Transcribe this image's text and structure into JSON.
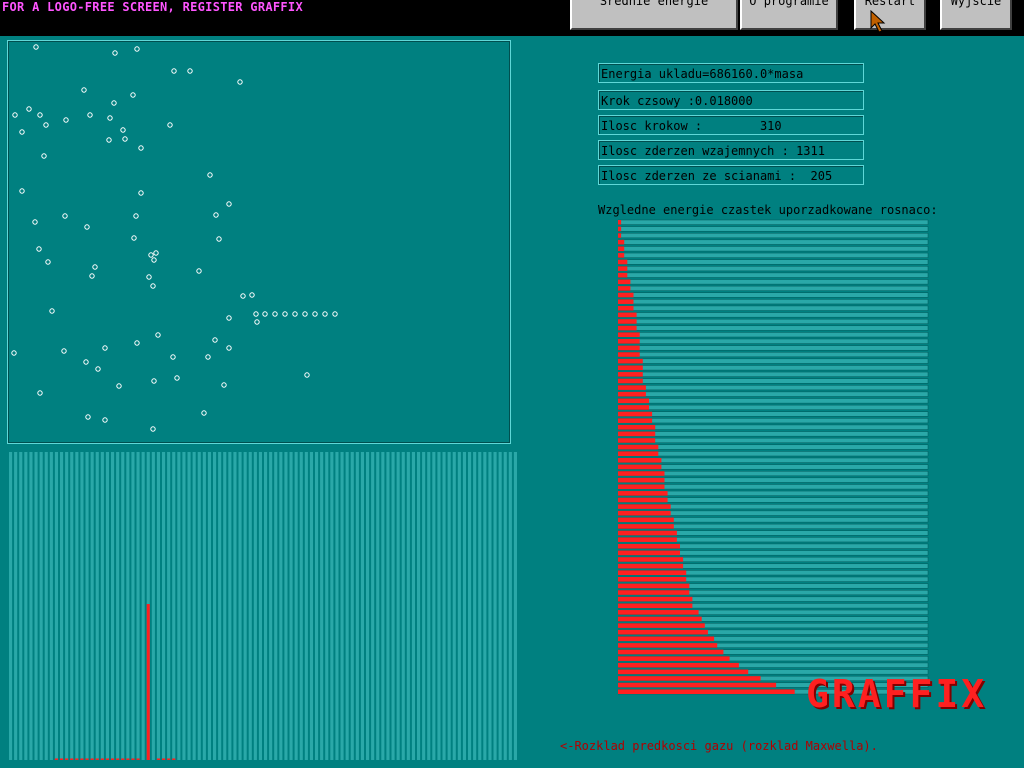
{
  "banner": "FOR A LOGO-FREE SCREEN, REGISTER GRAFFIX",
  "toolbar": {
    "buttons": [
      "Srednie energie",
      "O programie",
      "Restart",
      "Wyjscie"
    ]
  },
  "info": {
    "energy": "Energia ukladu=686160.0*masa",
    "timestep": "Krok czsowy :0.018000",
    "steps": "Ilosc krokow :        310",
    "mutual_collisions": "Ilosc zderzen wzajemnych : 1311",
    "wall_collisions": "Ilosc zderzen ze scianami :  205"
  },
  "energy_title": "Wzgledne energie czastek uporzadkowane rosnaco:",
  "logo": "GRAFFIX",
  "footer": "<-Rozklad predkosci gazu (rozklad Maxwella).",
  "colors": {
    "background": "#008080",
    "bar": "#ff2020",
    "banner": "#ff55ff",
    "footer": "#b00000"
  },
  "chart_data": [
    {
      "type": "bar",
      "title": "Wzgledne energie czastek uporzadkowane rosnaco:",
      "orientation": "horizontal",
      "values": [
        1,
        1,
        1,
        2,
        2,
        2,
        3,
        3,
        3,
        4,
        4,
        5,
        5,
        5,
        6,
        6,
        6,
        7,
        7,
        7,
        7,
        8,
        8,
        8,
        8,
        9,
        9,
        10,
        10,
        11,
        11,
        12,
        12,
        12,
        13,
        13,
        14,
        14,
        15,
        15,
        15,
        16,
        16,
        17,
        17,
        18,
        18,
        19,
        19,
        20,
        20,
        21,
        21,
        22,
        22,
        23,
        23,
        24,
        24,
        26,
        27,
        28,
        29,
        31,
        32,
        34,
        36,
        39,
        42,
        46,
        51,
        57
      ],
      "xlim": [
        0,
        100
      ]
    },
    {
      "type": "bar",
      "title": "Rozklad predkosci gazu (rozklad Maxwella)",
      "categories_count": 100,
      "values": [
        0,
        0,
        0,
        0,
        0,
        0,
        0,
        0,
        0,
        1,
        1,
        1,
        1,
        1,
        1,
        1,
        1,
        1,
        1,
        1,
        1,
        1,
        1,
        1,
        1,
        1,
        0,
        100,
        0,
        1,
        1,
        1,
        1,
        0,
        0,
        0,
        0,
        0,
        0,
        0,
        0,
        0,
        0,
        0,
        0,
        0,
        0,
        0,
        0,
        0,
        0,
        0,
        0,
        0,
        0,
        0,
        0,
        0,
        0,
        0,
        0,
        0,
        0,
        0,
        0,
        0,
        0,
        0,
        0,
        0,
        0,
        0,
        0,
        0,
        0,
        0,
        0,
        0,
        0,
        0,
        0,
        0,
        0,
        0,
        0,
        0,
        0,
        0,
        0,
        0,
        0,
        0,
        0,
        0,
        0,
        0,
        0,
        0,
        0,
        0
      ],
      "ylim": [
        0,
        100
      ]
    }
  ],
  "particles": [
    [
      35,
      46
    ],
    [
      114,
      52
    ],
    [
      136,
      48
    ],
    [
      173,
      70
    ],
    [
      189,
      70
    ],
    [
      239,
      81
    ],
    [
      83,
      89
    ],
    [
      132,
      94
    ],
    [
      113,
      102
    ],
    [
      28,
      108
    ],
    [
      14,
      114
    ],
    [
      39,
      114
    ],
    [
      65,
      119
    ],
    [
      89,
      114
    ],
    [
      109,
      117
    ],
    [
      45,
      124
    ],
    [
      21,
      131
    ],
    [
      122,
      129
    ],
    [
      108,
      139
    ],
    [
      124,
      138
    ],
    [
      169,
      124
    ],
    [
      140,
      147
    ],
    [
      43,
      155
    ],
    [
      209,
      174
    ],
    [
      21,
      190
    ],
    [
      140,
      192
    ],
    [
      228,
      203
    ],
    [
      64,
      215
    ],
    [
      135,
      215
    ],
    [
      215,
      214
    ],
    [
      34,
      221
    ],
    [
      86,
      226
    ],
    [
      133,
      237
    ],
    [
      218,
      238
    ],
    [
      38,
      248
    ],
    [
      150,
      254
    ],
    [
      155,
      252
    ],
    [
      153,
      259
    ],
    [
      47,
      261
    ],
    [
      94,
      266
    ],
    [
      198,
      270
    ],
    [
      91,
      275
    ],
    [
      148,
      276
    ],
    [
      152,
      285
    ],
    [
      242,
      295
    ],
    [
      251,
      294
    ],
    [
      51,
      310
    ],
    [
      255,
      313
    ],
    [
      264,
      313
    ],
    [
      274,
      313
    ],
    [
      284,
      313
    ],
    [
      294,
      313
    ],
    [
      304,
      313
    ],
    [
      314,
      313
    ],
    [
      324,
      313
    ],
    [
      334,
      313
    ],
    [
      228,
      317
    ],
    [
      256,
      321
    ],
    [
      157,
      334
    ],
    [
      214,
      339
    ],
    [
      136,
      342
    ],
    [
      228,
      347
    ],
    [
      104,
      347
    ],
    [
      63,
      350
    ],
    [
      13,
      352
    ],
    [
      172,
      356
    ],
    [
      207,
      356
    ],
    [
      85,
      361
    ],
    [
      97,
      368
    ],
    [
      306,
      374
    ],
    [
      176,
      377
    ],
    [
      153,
      380
    ],
    [
      118,
      385
    ],
    [
      223,
      384
    ],
    [
      39,
      392
    ],
    [
      203,
      412
    ],
    [
      87,
      416
    ],
    [
      104,
      419
    ],
    [
      152,
      428
    ]
  ]
}
